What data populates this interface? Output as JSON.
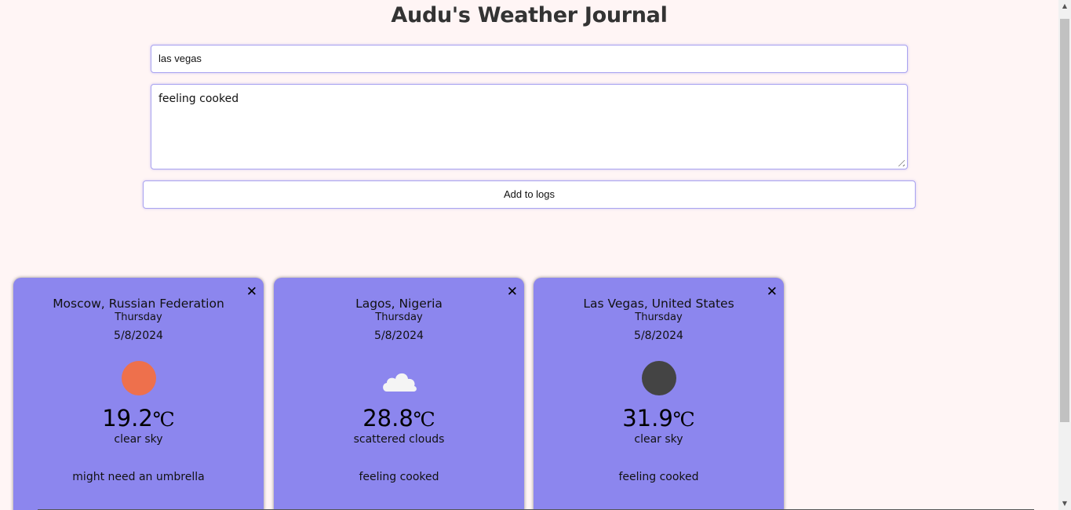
{
  "header": {
    "title": "Audu's Weather Journal"
  },
  "form": {
    "city_value": "las vegas",
    "note_value": "feeling cooked",
    "add_label": "Add to logs"
  },
  "cards": [
    {
      "city": "Moscow, Russian Federation",
      "day": "Thursday",
      "date": "5/8/2024",
      "icon": "sun-icon",
      "icon_color": "#ee704c",
      "temp": "19.2",
      "unit": "℃",
      "desc": "clear sky",
      "note": "might need an umbrella",
      "close": "✕"
    },
    {
      "city": "Lagos, Nigeria",
      "day": "Thursday",
      "date": "5/8/2024",
      "icon": "cloud-icon",
      "icon_color": "#f4f4f4",
      "temp": "28.8",
      "unit": "℃",
      "desc": "scattered clouds",
      "note": "feeling cooked",
      "close": "✕"
    },
    {
      "city": "Las Vegas, United States",
      "day": "Thursday",
      "date": "5/8/2024",
      "icon": "moon-icon",
      "icon_color": "#444444",
      "temp": "31.9",
      "unit": "℃",
      "desc": "clear sky",
      "note": "feeling cooked",
      "close": "✕"
    }
  ],
  "colors": {
    "background": "#fff5f5",
    "card": "#8c86ee",
    "input_border": "#a9a3f0"
  }
}
